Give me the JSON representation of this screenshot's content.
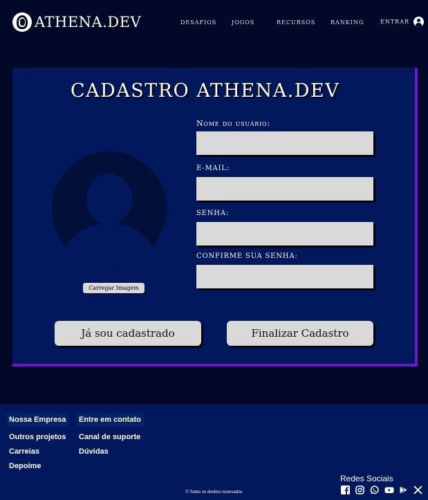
{
  "header": {
    "logo_text": "ATHENA.DEV",
    "nav": [
      "DESAFIOS",
      "JOGOS",
      "RECURSOS",
      "RANKING"
    ],
    "login_label": "ENTRAR"
  },
  "form": {
    "title": "CADASTRO ATHENA.DEV",
    "upload_label": "Carregar Imagem",
    "username_label": "Nome do usuário:",
    "email_label": "E-MAIL:",
    "password_label": "SENHA:",
    "confirm_label": "CONFIRME SUA SENHA:",
    "username_value": "",
    "email_value": "",
    "password_value": "",
    "confirm_value": "",
    "login_button": "Já sou cadastrado",
    "submit_button": "Finalizar Cadastro"
  },
  "footer": {
    "col1_title": "Nossa Empresa",
    "col1_links": [
      "Outros projetos",
      "Carreias",
      "Depoime"
    ],
    "col2_title": "Entre em contato",
    "col2_links": [
      "Canal de suporte",
      "Dúvidas"
    ],
    "copyright": "© Todos os direitos reservados",
    "social_title": "Redes Sociais",
    "social_icons": [
      "facebook-icon",
      "instagram-icon",
      "whatsapp-icon",
      "youtube-icon",
      "play-store-icon",
      "x-twitter-icon"
    ]
  },
  "colors": {
    "background": "#010828",
    "card": "#01185c",
    "card_border": "#6a16d0",
    "input": "#d9d9d9"
  }
}
